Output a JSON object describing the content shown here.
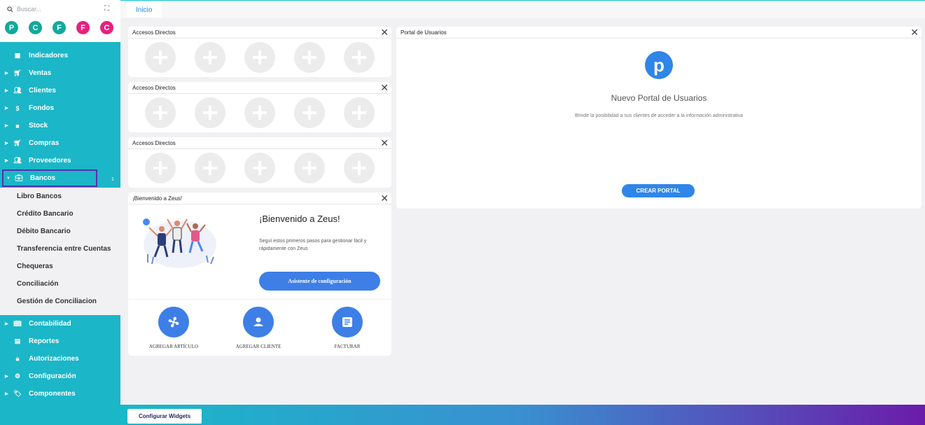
{
  "search": {
    "placeholder": "Buscar..."
  },
  "circles": [
    {
      "letter": "P",
      "color": "#12a89d"
    },
    {
      "letter": "C",
      "color": "#12a89d"
    },
    {
      "letter": "F",
      "color": "#12a89d"
    },
    {
      "letter": "F",
      "color": "#e5217c"
    },
    {
      "letter": "C",
      "color": "#e5217c"
    }
  ],
  "nav": {
    "indicadores": "Indicadores",
    "ventas": "Ventas",
    "clientes": "Clientes",
    "fondos": "Fondos",
    "stock": "Stock",
    "compras": "Compras",
    "proveedores": "Proveedores",
    "bancos": "Bancos",
    "bancos_badge": "1",
    "contabilidad": "Contabilidad",
    "reportes": "Reportes",
    "autorizaciones": "Autorizaciones",
    "configuracion": "Configuración",
    "componentes": "Componentes"
  },
  "bancos_sub": {
    "libro": "Libro Bancos",
    "credito": "Crédito Bancario",
    "debito": "Débito Bancario",
    "transferencia": "Transferencia entre Cuentas",
    "chequeras": "Chequeras",
    "conciliacion": "Conciliación",
    "gestion": "Gestión de Conciliacion"
  },
  "tabs": {
    "inicio": "Inicio"
  },
  "widgets": {
    "accesos_title": "Accesos Directos",
    "welcome_header": "¡Bienvenido a Zeus!",
    "welcome_title": "¡Bienvenido a Zeus!",
    "welcome_text": "Seguí estos primeros pasos para gestionar fácil y rápidamente con Zeus",
    "wizard_button": "Asistente de configuración",
    "quick_articulo": "AGREGAR ARTÍCULO",
    "quick_cliente": "AGREGAR CLIENTE",
    "quick_facturar": "FACTURAR",
    "portal_header": "Portal de Usuarios",
    "portal_logo": "p",
    "portal_title": "Nuevo Portal de Usuarios",
    "portal_text": "Brinde la posibilidad a sus clientes de acceder a la información administrativa",
    "portal_button": "CREAR PORTAL",
    "close": "✕"
  },
  "footer": {
    "configure": "Configurar Widgets"
  },
  "colors": {
    "sidebar": "#1bb6c8",
    "accent": "#3d7fe6",
    "active_border": "#5a2fae"
  }
}
